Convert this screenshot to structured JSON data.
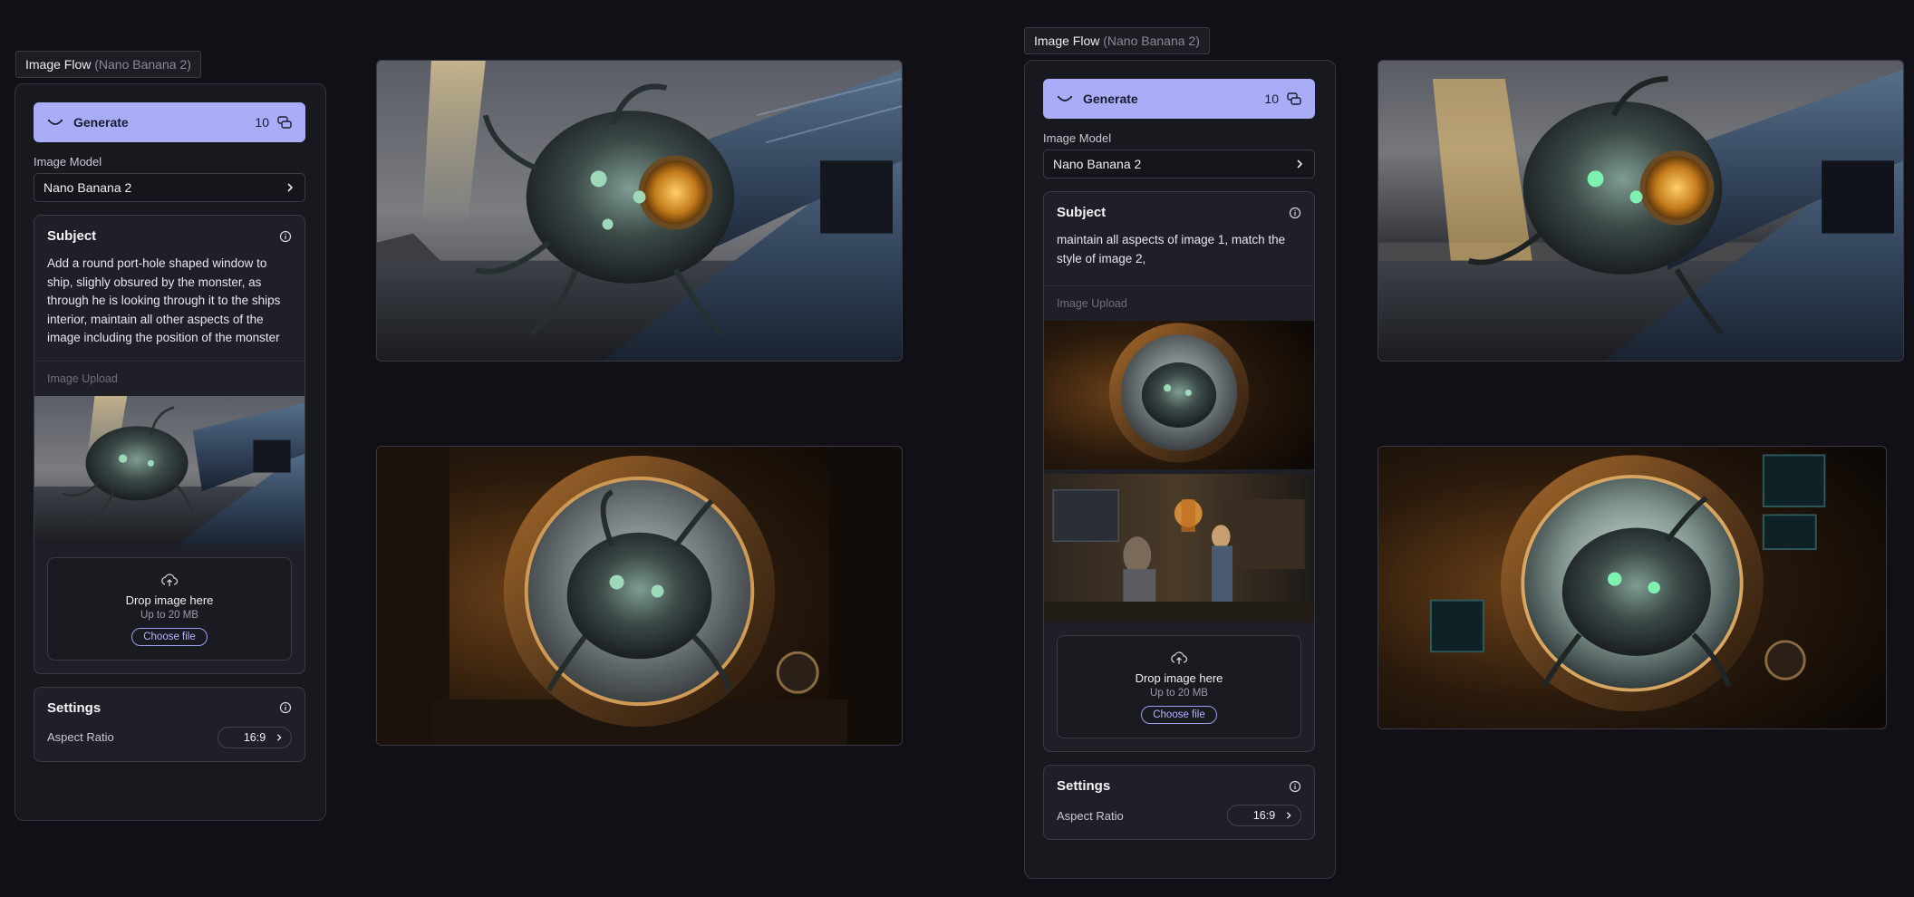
{
  "nodes": [
    {
      "tag_title": "Image Flow",
      "tag_model": "(Nano Banana 2)",
      "generate_label": "Generate",
      "credits": "10",
      "model_label": "Image Model",
      "model_value": "Nano Banana 2",
      "subject_title": "Subject",
      "subject_text": "Add a round port-hole shaped window to ship, slighly obsured by the monster, as through he is looking through it to the ships interior, maintain all other aspects of the image including the position of the monster",
      "upload_label": "Image Upload",
      "drop_title": "Drop image here",
      "drop_sub": "Up to 20 MB",
      "choose_label": "Choose file",
      "settings_title": "Settings",
      "aspect_label": "Aspect Ratio",
      "aspect_value": "16:9"
    },
    {
      "tag_title": "Image Flow",
      "tag_model": "(Nano Banana 2)",
      "generate_label": "Generate",
      "credits": "10",
      "model_label": "Image Model",
      "model_value": "Nano Banana 2",
      "subject_title": "Subject",
      "subject_text": "maintain all aspects of  image 1, match the style of image 2,",
      "upload_label": "Image Upload",
      "drop_title": "Drop image here",
      "drop_sub": "Up to 20 MB",
      "choose_label": "Choose file",
      "settings_title": "Settings",
      "aspect_label": "Aspect Ratio",
      "aspect_value": "16:9"
    }
  ],
  "icons": {
    "generate": "smile-icon",
    "credits": "coins-icon",
    "chevron": "chevron-right-icon",
    "info": "info-icon",
    "upload": "cloud-upload-icon"
  },
  "colors": {
    "accent": "#a9adf8",
    "background": "#111016",
    "panel": "#18181f",
    "card": "#1f1f28"
  }
}
